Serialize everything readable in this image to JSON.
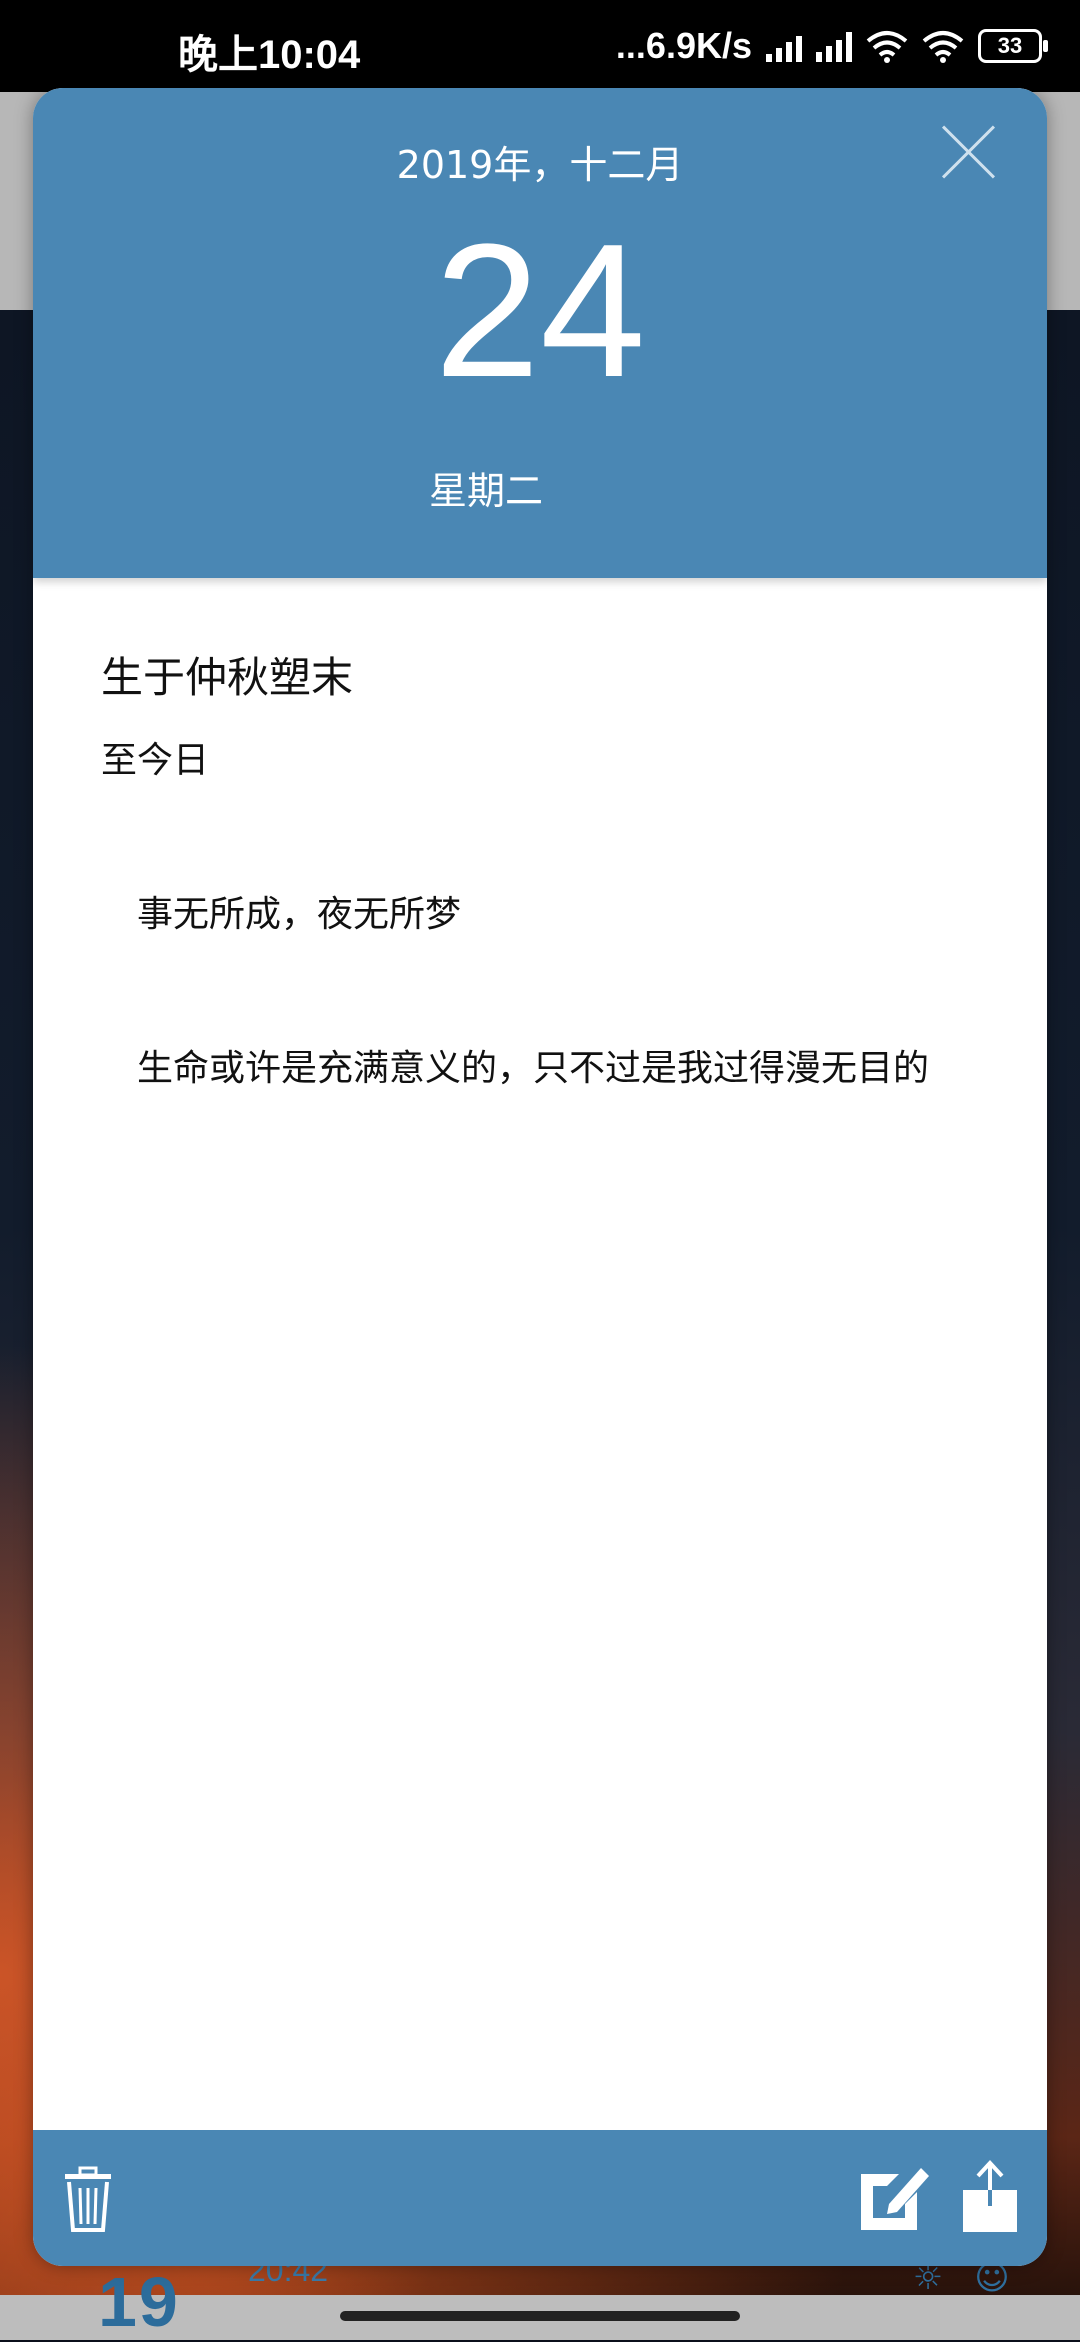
{
  "status_bar": {
    "time": "晚上10:04",
    "net_speed": "...6.9K/s",
    "battery": "33"
  },
  "background": {
    "day": "19",
    "time": "20:42"
  },
  "dialog": {
    "header": {
      "month_year": "2019年，十二月",
      "day": "24",
      "weekday": "星期二"
    },
    "entry": {
      "title": "生于仲秋塑末",
      "paragraphs": [
        "至今日",
        "",
        "　事无所成，夜无所梦",
        "",
        "　生命或许是充满意义的，只不过是我过得漫无目的"
      ]
    },
    "footer": {
      "icons": [
        "trash-icon",
        "edit-icon",
        "share-icon"
      ]
    }
  },
  "colors": {
    "accent": "#4a87b4",
    "close_icon": "#cfe1ee"
  }
}
